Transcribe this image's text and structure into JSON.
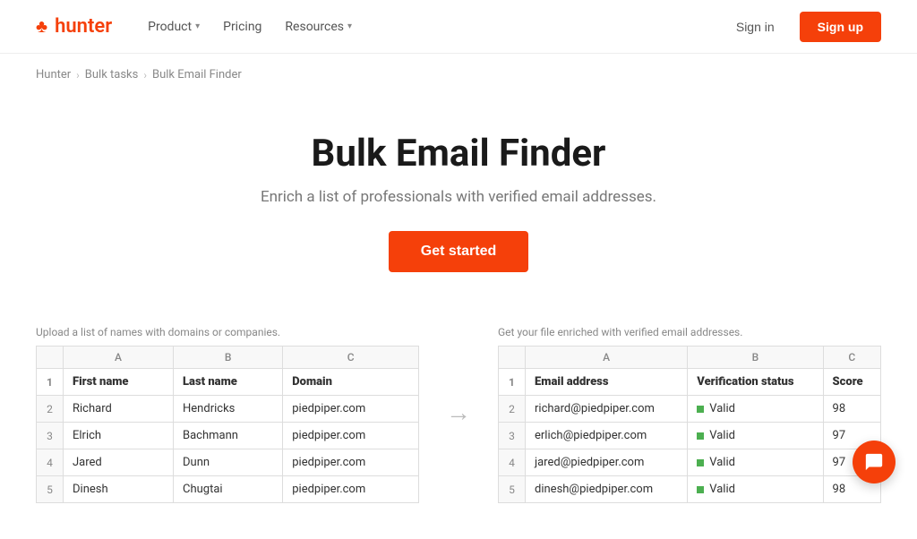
{
  "nav": {
    "logo_leaf": "♣",
    "logo_text": "hunter",
    "links": [
      {
        "label": "Product",
        "has_chevron": true
      },
      {
        "label": "Pricing",
        "has_chevron": false
      },
      {
        "label": "Resources",
        "has_chevron": true
      }
    ],
    "signin_label": "Sign in",
    "signup_label": "Sign up"
  },
  "breadcrumb": {
    "items": [
      {
        "label": "Hunter",
        "href": "#"
      },
      {
        "label": "Bulk tasks",
        "href": "#"
      },
      {
        "label": "Bulk Email Finder",
        "href": "#"
      }
    ]
  },
  "hero": {
    "title": "Bulk Email Finder",
    "subtitle": "Enrich a list of professionals with verified email addresses.",
    "cta_label": "Get started"
  },
  "left_table": {
    "label": "Upload a list of names with domains or companies.",
    "col_headers": [
      "",
      "A",
      "B",
      "C"
    ],
    "header_row": {
      "num": "1",
      "cols": [
        "First name",
        "Last name",
        "Domain"
      ]
    },
    "rows": [
      {
        "num": "2",
        "cols": [
          "Richard",
          "Hendricks",
          "piedpiper.com"
        ]
      },
      {
        "num": "3",
        "cols": [
          "Elrich",
          "Bachmann",
          "piedpiper.com"
        ]
      },
      {
        "num": "4",
        "cols": [
          "Jared",
          "Dunn",
          "piedpiper.com"
        ]
      },
      {
        "num": "5",
        "cols": [
          "Dinesh",
          "Chugtai",
          "piedpiper.com"
        ]
      }
    ]
  },
  "right_table": {
    "label": "Get your file enriched with verified email addresses.",
    "col_headers": [
      "",
      "A",
      "B",
      "C"
    ],
    "header_row": {
      "num": "1",
      "cols": [
        "Email address",
        "Verification status",
        "Score"
      ]
    },
    "rows": [
      {
        "num": "2",
        "email": "richard@piedpiper.com",
        "status": "Valid",
        "score": "98"
      },
      {
        "num": "3",
        "email": "erlich@piedpiper.com",
        "status": "Valid",
        "score": "97"
      },
      {
        "num": "4",
        "email": "jared@piedpiper.com",
        "status": "Valid",
        "score": "97"
      },
      {
        "num": "5",
        "email": "dinesh@piedpiper.com",
        "status": "Valid",
        "score": "98"
      }
    ]
  },
  "colors": {
    "brand": "#f5400a",
    "valid_dot": "#4caf50"
  }
}
